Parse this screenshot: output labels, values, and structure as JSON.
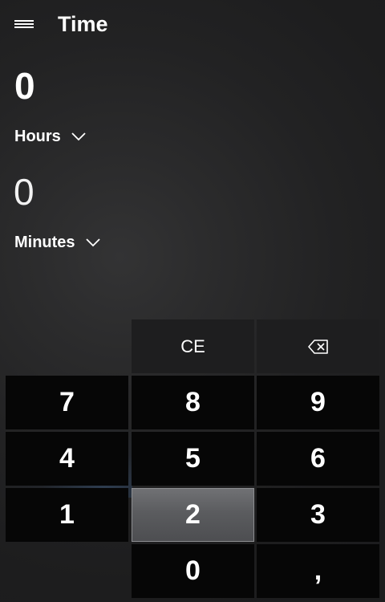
{
  "app": {
    "title": "Time",
    "menu_icon": "hamburger-menu-icon"
  },
  "converter": {
    "from": {
      "value": "0",
      "unit": "Hours",
      "dropdown_icon": "chevron-down-icon"
    },
    "to": {
      "value": "0",
      "unit": "Minutes",
      "dropdown_icon": "chevron-down-icon"
    }
  },
  "keypad": {
    "clear_entry": "CE",
    "backspace_icon": "backspace-icon",
    "digits": {
      "seven": "7",
      "eight": "8",
      "nine": "9",
      "four": "4",
      "five": "5",
      "six": "6",
      "one": "1",
      "two": "2",
      "three": "3",
      "zero": "0"
    },
    "decimal": ",",
    "pressed_key": "2"
  },
  "colors": {
    "background": "#1f1f20",
    "number_key": "#060606",
    "utility_key": "#1e1e1f",
    "pressed_key": "#5f6063",
    "text": "#ffffff"
  }
}
